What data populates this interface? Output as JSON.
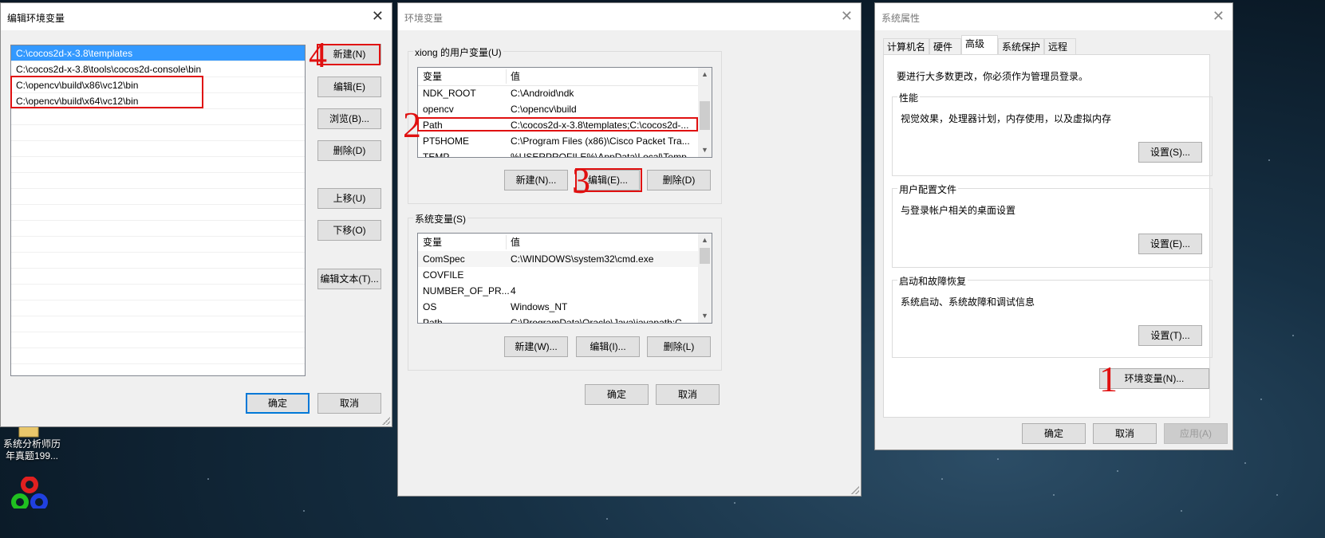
{
  "edit_env_dialog": {
    "title": "编辑环境变量",
    "paths": [
      "C:\\cocos2d-x-3.8\\templates",
      "C:\\cocos2d-x-3.8\\tools\\cocos2d-console\\bin",
      "C:\\opencv\\build\\x86\\vc12\\bin",
      "C:\\opencv\\build\\x64\\vc12\\bin"
    ],
    "buttons": {
      "new": "新建(N)",
      "edit": "编辑(E)",
      "browse": "浏览(B)...",
      "delete": "删除(D)",
      "move_up": "上移(U)",
      "move_down": "下移(O)",
      "edit_text": "编辑文本(T)...",
      "ok": "确定",
      "cancel": "取消"
    }
  },
  "env_vars_dialog": {
    "title": "环境变量",
    "user_group_label": "xiong 的用户变量(U)",
    "col_var": "变量",
    "col_val": "值",
    "user_vars": [
      {
        "name": "NDK_ROOT",
        "value": "C:\\Android\\ndk"
      },
      {
        "name": "opencv",
        "value": "C:\\opencv\\build"
      },
      {
        "name": "Path",
        "value": "C:\\cocos2d-x-3.8\\templates;C:\\cocos2d-..."
      },
      {
        "name": "PT5HOME",
        "value": "C:\\Program Files (x86)\\Cisco Packet Tra..."
      },
      {
        "name": "TEMP",
        "value": "%USERPROFILE%\\AppData\\Local\\Temp"
      }
    ],
    "user_buttons": {
      "new": "新建(N)...",
      "edit": "编辑(E)...",
      "delete": "删除(D)"
    },
    "system_group_label": "系统变量(S)",
    "system_vars": [
      {
        "name": "ComSpec",
        "value": "C:\\WINDOWS\\system32\\cmd.exe"
      },
      {
        "name": "COVFILE",
        "value": ""
      },
      {
        "name": "NUMBER_OF_PR...",
        "value": "4"
      },
      {
        "name": "OS",
        "value": "Windows_NT"
      },
      {
        "name": "Path",
        "value": "C:\\ProgramData\\Oracle\\Java\\javapath;C..."
      }
    ],
    "system_buttons": {
      "new": "新建(W)...",
      "edit": "编辑(I)...",
      "delete": "删除(L)"
    },
    "ok": "确定",
    "cancel": "取消"
  },
  "sys_props_dialog": {
    "title": "系统属性",
    "tabs": [
      "计算机名",
      "硬件",
      "高级",
      "系统保护",
      "远程"
    ],
    "active_tab": "高级",
    "admin_note": "要进行大多数更改，你必须作为管理员登录。",
    "performance": {
      "label": "性能",
      "desc": "视觉效果，处理器计划，内存使用，以及虚拟内存",
      "button": "设置(S)..."
    },
    "user_profiles": {
      "label": "用户配置文件",
      "desc": "与登录帐户相关的桌面设置",
      "button": "设置(E)..."
    },
    "startup": {
      "label": "启动和故障恢复",
      "desc": "系统启动、系统故障和调试信息",
      "button": "设置(T)..."
    },
    "env_button": "环境变量(N)...",
    "ok": "确定",
    "cancel": "取消",
    "apply": "应用(A)"
  },
  "annotations": {
    "step1": "1",
    "step2": "2",
    "step3": "3",
    "step4": "4"
  },
  "desktop": {
    "icon_label_line1": "系统分析师历",
    "icon_label_line2": "年真题199..."
  },
  "colors": {
    "selection": "#3399ff",
    "annotation_red": "#e01010",
    "default_button_border": "#0078d7"
  }
}
